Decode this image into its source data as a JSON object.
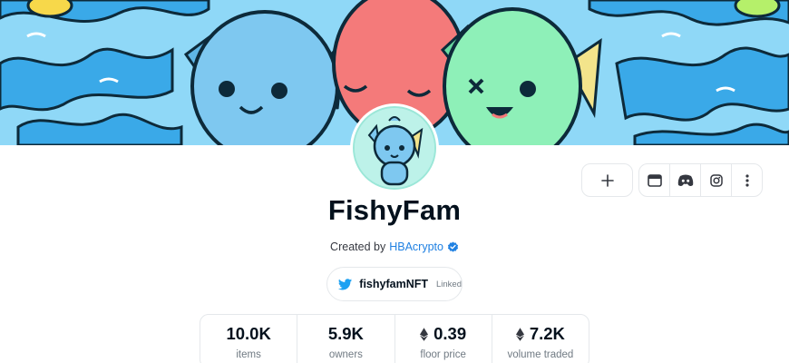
{
  "collection": {
    "name": "FishyFam",
    "created_by_prefix": "Created by",
    "creator": "HBAcrypto",
    "verified": true
  },
  "twitter": {
    "handle": "fishyfamNFT",
    "status": "Linked"
  },
  "actions": {
    "add_icon": "plus-icon",
    "website_icon": "browser-icon",
    "discord_icon": "discord-icon",
    "instagram_icon": "instagram-icon",
    "more_icon": "more-vertical-icon"
  },
  "stats": [
    {
      "value": "10.0K",
      "label": "items",
      "eth": false
    },
    {
      "value": "5.9K",
      "label": "owners",
      "eth": false
    },
    {
      "value": "0.39",
      "label": "floor price",
      "eth": true
    },
    {
      "value": "7.2K",
      "label": "volume traded",
      "eth": true
    }
  ],
  "colors": {
    "link": "#2081e2",
    "text": "#04111d",
    "muted": "#707a83",
    "border": "#e5e8eb",
    "banner_bg": "#4fc3f7",
    "fish_blue": "#7ec8f0",
    "fish_red": "#f47a7a",
    "fish_green": "#8ef0b8"
  }
}
